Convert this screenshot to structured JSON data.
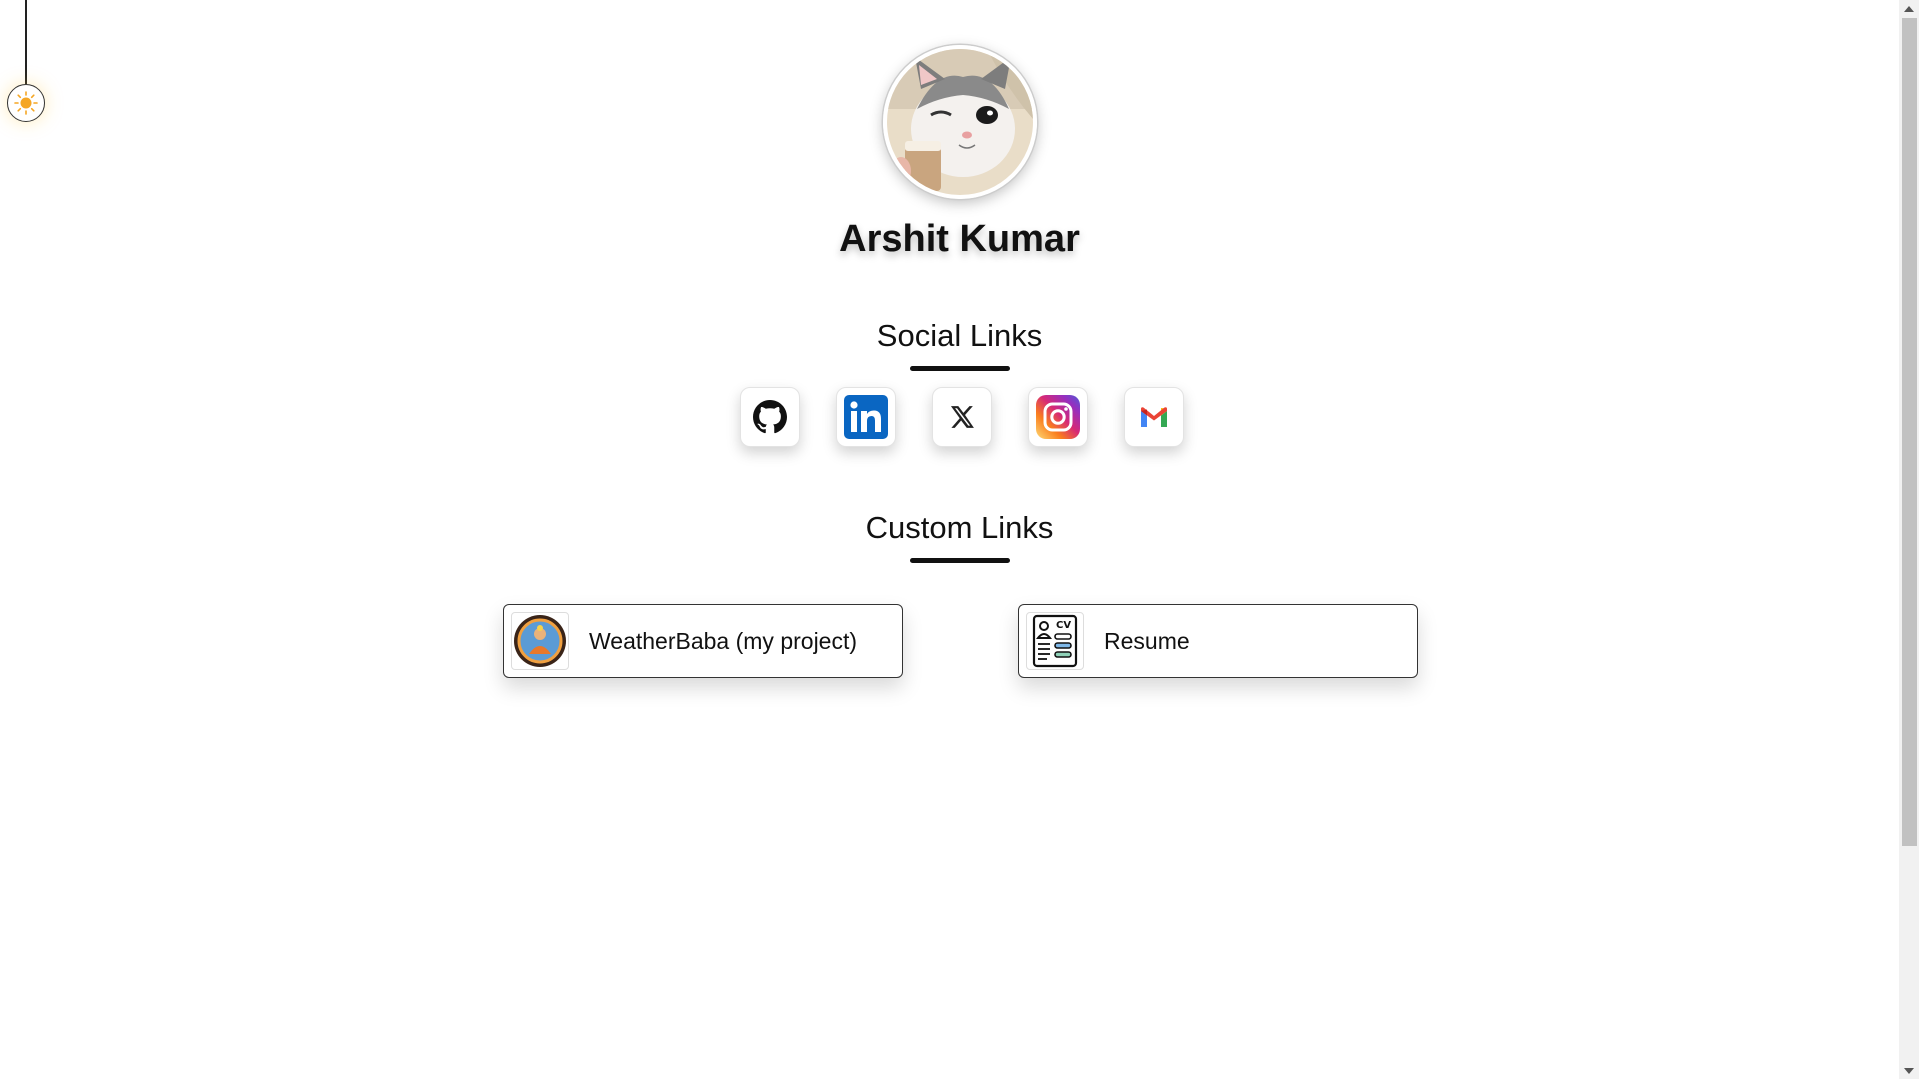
{
  "profile": {
    "name": "Arshit Kumar"
  },
  "sections": {
    "social_title": "Social Links",
    "custom_title": "Custom Links"
  },
  "social_links": [
    {
      "icon": "github-icon",
      "color": "#111111"
    },
    {
      "icon": "linkedin-icon",
      "color": "#0a66c2"
    },
    {
      "icon": "x-twitter-icon",
      "color": "#222222"
    },
    {
      "icon": "instagram-icon",
      "color": "#e1306c"
    },
    {
      "icon": "gmail-icon",
      "color": "#ea4335"
    }
  ],
  "custom_links": [
    {
      "label": "WeatherBaba (my project)",
      "icon": "weatherbaba-logo-icon"
    },
    {
      "label": "Resume",
      "icon": "cv-document-icon"
    }
  ],
  "theme_toggle": {
    "icon": "sun-icon",
    "accent": "#f5a623"
  }
}
